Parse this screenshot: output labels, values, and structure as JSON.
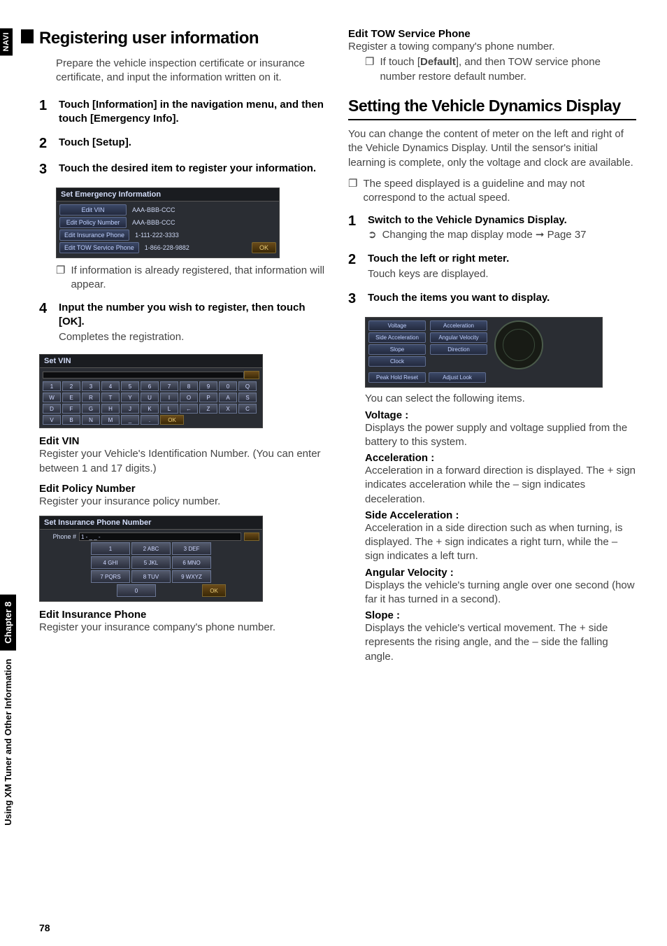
{
  "page_number": "78",
  "side_tab": "NAVI",
  "side_chapter_label": "Chapter 8",
  "side_chapter_text": "Using XM Tuner and Other Information",
  "left": {
    "title": "Registering user information",
    "intro": "Prepare the vehicle inspection certificate or insurance certificate, and input the information written on it.",
    "step1": "Touch [Information] in the navigation menu, and then touch [Emergency Info].",
    "step2": "Touch [Setup].",
    "step3": "Touch the desired item to register your information.",
    "scr1": {
      "title": "Set Emergency Information",
      "rows": [
        {
          "label": "Edit VIN",
          "value": "AAA-BBB-CCC"
        },
        {
          "label": "Edit Policy Number",
          "value": "AAA-BBB-CCC"
        },
        {
          "label": "Edit Insurance Phone",
          "value": "1-111-222-3333"
        },
        {
          "label": "Edit TOW Service Phone",
          "value": "1-866-228-9882"
        }
      ],
      "ok": "OK"
    },
    "note_after_scr1": "If information is already registered, that information will appear.",
    "step4": "Input the number you wish to register, then touch [OK].",
    "step4_sub": "Completes the registration.",
    "scr2": {
      "title": "Set VIN",
      "row1": [
        "1",
        "2",
        "3",
        "4",
        "5",
        "6",
        "7",
        "8",
        "9",
        "0"
      ],
      "row2": [
        "Q",
        "W",
        "E",
        "R",
        "T",
        "Y",
        "U",
        "I",
        "O",
        "P"
      ],
      "row3": [
        "A",
        "S",
        "D",
        "F",
        "G",
        "H",
        "J",
        "K",
        "L",
        "←"
      ],
      "row4": [
        "Z",
        "X",
        "C",
        "V",
        "B",
        "N",
        "M",
        "_",
        ".",
        "OK"
      ]
    },
    "sub1_h": "Edit VIN",
    "sub1_t": "Register your Vehicle's Identification Number. (You can enter between 1 and 17 digits.)",
    "sub2_h": "Edit Policy Number",
    "sub2_t": "Register your insurance policy number.",
    "scr3": {
      "title": "Set Insurance Phone Number",
      "label": "Phone #",
      "input_placeholder": "1 - _ _   -",
      "keys": [
        [
          "1",
          "2 ABC",
          "3 DEF"
        ],
        [
          "4 GHI",
          "5 JKL",
          "6 MNO"
        ],
        [
          "7 PQRS",
          "8 TUV",
          "9 WXYZ"
        ],
        [
          "",
          "0",
          ""
        ]
      ],
      "ok": "OK"
    },
    "sub3_h": "Edit Insurance Phone",
    "sub3_t": "Register your insurance company's phone number."
  },
  "right": {
    "tow_h": "Edit TOW Service Phone",
    "tow_t": "Register a towing company's phone number.",
    "tow_note_pre": "If touch [",
    "tow_note_bold": "Default",
    "tow_note_post": "], and then TOW service phone number restore default number.",
    "sec2_title": "Setting the Vehicle Dynamics Display",
    "sec2_intro": "You can change the content of meter on the left and right of the Vehicle Dynamics Display. Until the sensor's initial learning is complete, only the voltage and clock are available.",
    "sec2_note": "The speed displayed is a guideline and may not correspond to the actual speed.",
    "r_step1": "Switch to the Vehicle Dynamics Display.",
    "r_step1_link": "Changing the map display mode ➞ Page 37",
    "r_step2": "Touch the left or right meter.",
    "r_step2_sub": "Touch keys are displayed.",
    "r_step3": "Touch the items you want to display.",
    "scr4": {
      "left_items": [
        "Voltage",
        "Side Acceleration",
        "Slope",
        "Clock"
      ],
      "right_items": [
        "Acceleration",
        "Angular Velocity",
        "Direction"
      ],
      "bottom_left": "Peak Hold Reset",
      "bottom_right": "Adjust Look"
    },
    "post_scr4": "You can select the following items.",
    "def_voltage_h": "Voltage :",
    "def_voltage_t": "Displays the power supply and voltage supplied from the battery to this system.",
    "def_accel_h": "Acceleration :",
    "def_accel_t": "Acceleration in a forward direction is displayed. The + sign indicates acceleration while the – sign indicates deceleration.",
    "def_side_h": "Side Acceleration :",
    "def_side_t": "Acceleration in a side direction such as when turning, is displayed. The + sign indicates a right turn, while the – sign indicates a left turn.",
    "def_ang_h": "Angular Velocity :",
    "def_ang_t": "Displays the vehicle's turning angle over one second (how far it has turned in a second).",
    "def_slope_h": "Slope :",
    "def_slope_t": "Displays the vehicle's vertical movement. The + side represents the rising angle, and the – side the falling angle."
  }
}
